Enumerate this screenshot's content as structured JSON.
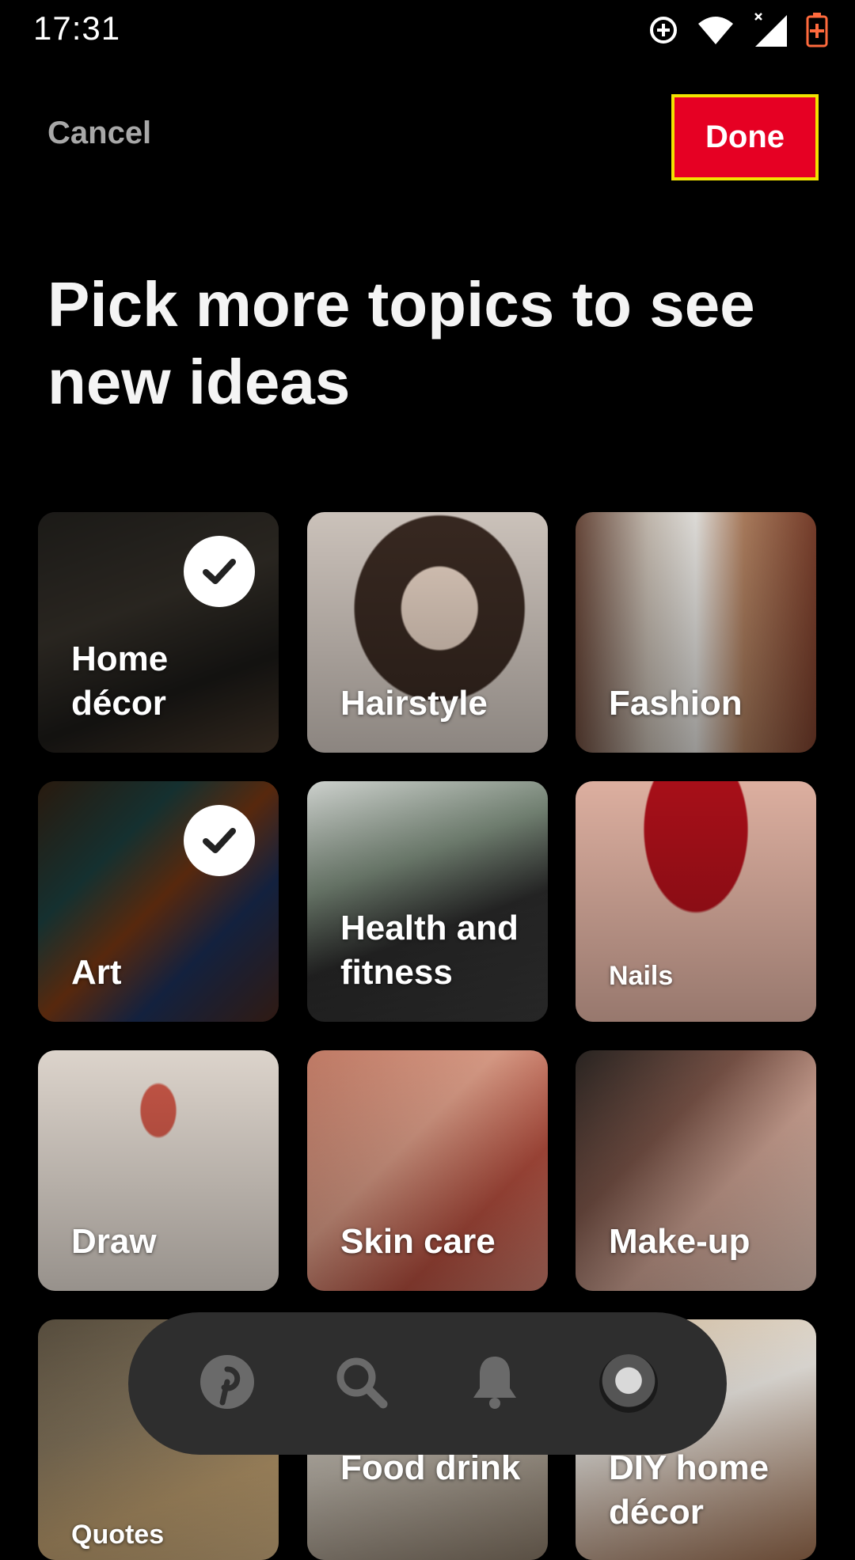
{
  "status_bar": {
    "time": "17:31"
  },
  "header": {
    "cancel_label": "Cancel",
    "done_label": "Done"
  },
  "title": "Pick more topics to see new ideas",
  "topics": [
    {
      "label": "Home décor",
      "selected": true
    },
    {
      "label": "Hairstyle",
      "selected": false
    },
    {
      "label": "Fashion",
      "selected": false
    },
    {
      "label": "Art",
      "selected": true
    },
    {
      "label": "Health and fitness",
      "selected": false
    },
    {
      "label": "Nails",
      "selected": false
    },
    {
      "label": "Draw",
      "selected": false
    },
    {
      "label": "Skin care",
      "selected": false
    },
    {
      "label": "Make-up",
      "selected": false
    },
    {
      "label": "Quotes",
      "selected": false
    },
    {
      "label": "Food drink",
      "selected": false
    },
    {
      "label": "DIY home décor",
      "selected": false
    }
  ],
  "bottom_nav": {
    "items": [
      {
        "icon": "pinterest-home-icon"
      },
      {
        "icon": "search-icon"
      },
      {
        "icon": "bell-icon"
      },
      {
        "icon": "profile-avatar"
      }
    ]
  },
  "colors": {
    "accent": "#e60023",
    "focus_outline": "#f2e300",
    "background": "#000000",
    "nav_background": "#2e2e2e"
  }
}
